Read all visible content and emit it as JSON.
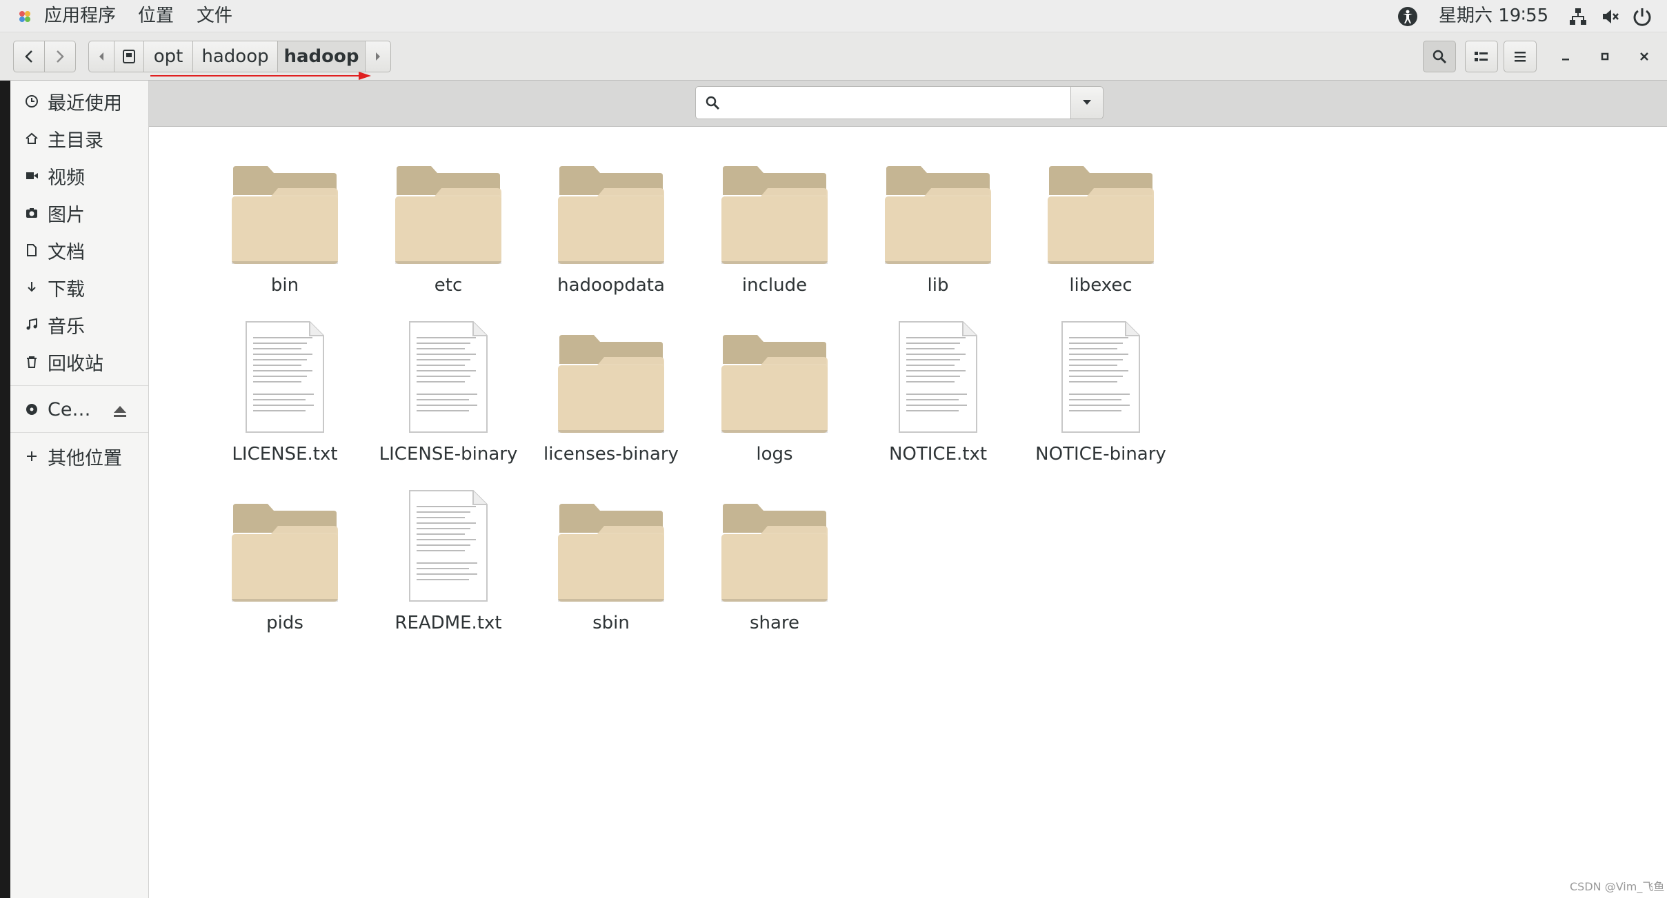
{
  "topbar": {
    "apps_label": "应用程序",
    "places_label": "位置",
    "files_label": "文件",
    "clock": "星期六 19∶55",
    "icons": [
      "accessibility-icon",
      "network-icon",
      "volume-icon",
      "power-icon"
    ]
  },
  "header": {
    "path": [
      "opt",
      "hadoop",
      "hadoop"
    ],
    "current_index": 2,
    "window_buttons": [
      "minimize",
      "maximize",
      "close"
    ]
  },
  "sidebar": {
    "items": [
      {
        "label": "最近使用",
        "icon": "clock-icon"
      },
      {
        "label": "主目录",
        "icon": "home-icon"
      },
      {
        "label": "视频",
        "icon": "video-icon"
      },
      {
        "label": "图片",
        "icon": "camera-icon"
      },
      {
        "label": "文档",
        "icon": "document-icon"
      },
      {
        "label": "下载",
        "icon": "download-icon"
      },
      {
        "label": "音乐",
        "icon": "music-icon"
      },
      {
        "label": "回收站",
        "icon": "trash-icon"
      }
    ],
    "device": {
      "label": "Ce…",
      "icon": "disc-icon",
      "action_icon": "eject-icon"
    },
    "other": {
      "label": "其他位置",
      "icon": "plus-icon"
    }
  },
  "search": {
    "value": "",
    "placeholder": ""
  },
  "files": [
    {
      "name": "bin",
      "type": "folder"
    },
    {
      "name": "etc",
      "type": "folder"
    },
    {
      "name": "hadoopdata",
      "type": "folder"
    },
    {
      "name": "include",
      "type": "folder"
    },
    {
      "name": "lib",
      "type": "folder"
    },
    {
      "name": "libexec",
      "type": "folder"
    },
    {
      "name": "LICENSE.txt",
      "type": "text"
    },
    {
      "name": "LICENSE-binary",
      "type": "text"
    },
    {
      "name": "licenses-binary",
      "type": "folder"
    },
    {
      "name": "logs",
      "type": "folder"
    },
    {
      "name": "NOTICE.txt",
      "type": "text"
    },
    {
      "name": "NOTICE-binary",
      "type": "text"
    },
    {
      "name": "pids",
      "type": "folder"
    },
    {
      "name": "README.txt",
      "type": "text"
    },
    {
      "name": "sbin",
      "type": "folder"
    },
    {
      "name": "share",
      "type": "folder"
    }
  ],
  "watermark": "CSDN @Vim_飞鱼",
  "colors": {
    "folder_back": "#c5b593",
    "folder_front": "#e8d6b5",
    "annotation": "#e02020"
  }
}
